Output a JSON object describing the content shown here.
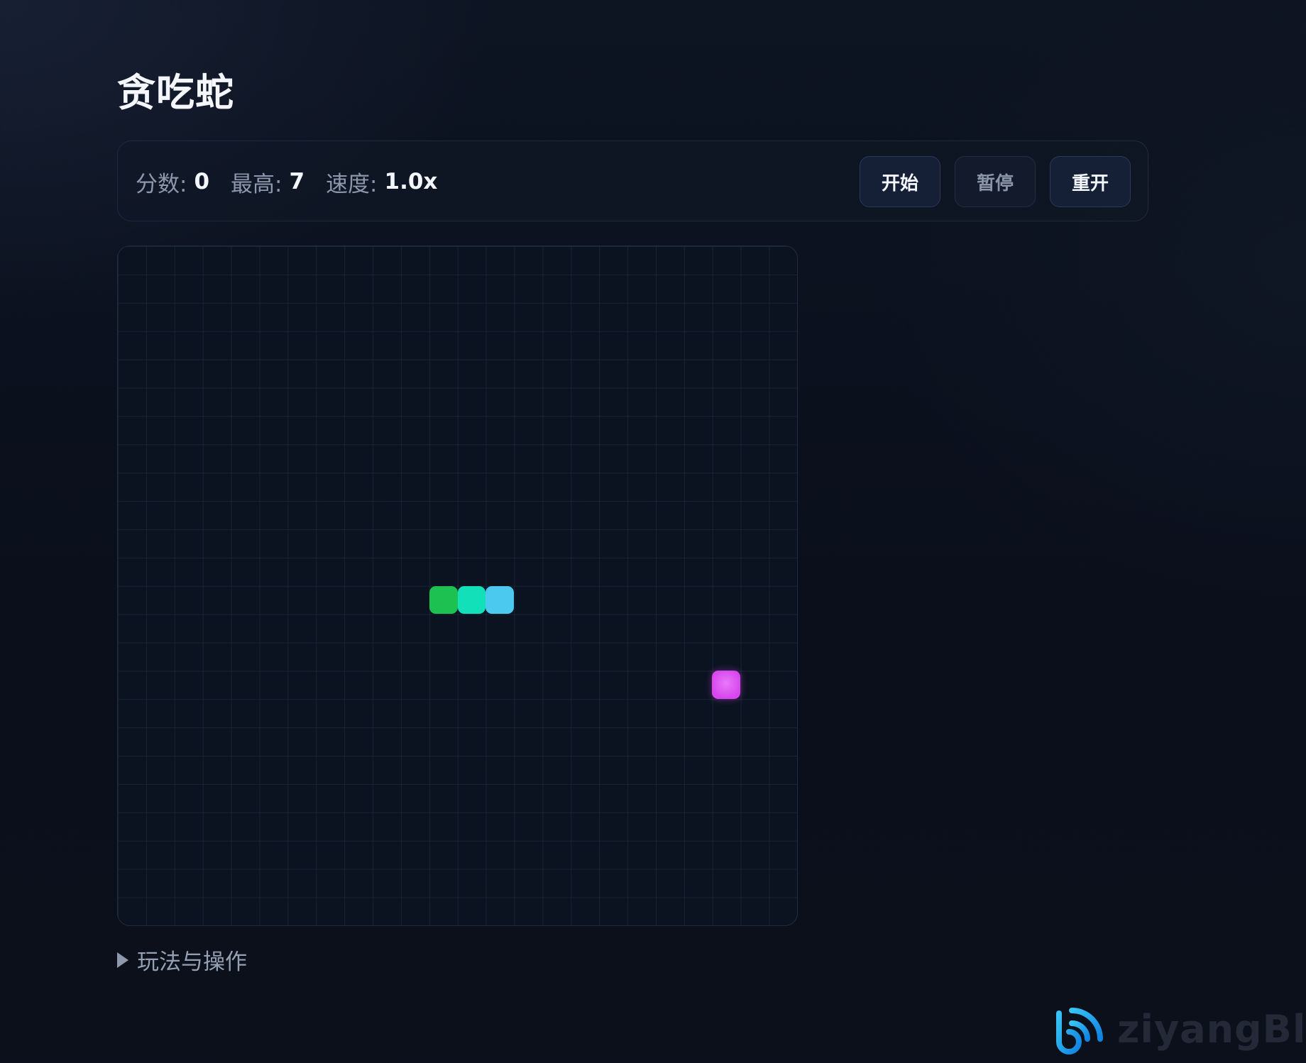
{
  "app": {
    "title": "贪吃蛇"
  },
  "stats": {
    "score_label": "分数:",
    "score_value": "0",
    "high_label": "最高:",
    "high_value": "7",
    "speed_label": "速度:",
    "speed_value": "1.0x"
  },
  "controls": {
    "start_label": "开始",
    "pause_label": "暂停",
    "restart_label": "重开",
    "pause_enabled": false
  },
  "board": {
    "grid_cols": 24,
    "grid_rows": 24,
    "snake": [
      {
        "col": 13,
        "row": 12,
        "color": "#4cc9ef",
        "part": "head"
      },
      {
        "col": 12,
        "row": 12,
        "color": "#12e0b8",
        "part": "body"
      },
      {
        "col": 11,
        "row": 12,
        "color": "#1dc152",
        "part": "tail"
      }
    ],
    "food": {
      "col": 21,
      "row": 15,
      "color": "#d946ef"
    }
  },
  "help": {
    "label": "玩法与操作",
    "expanded": false
  },
  "watermark": {
    "text": "ziyangBlog",
    "icon": "wifi-b-logo-icon",
    "color": "#1aa3e8"
  }
}
